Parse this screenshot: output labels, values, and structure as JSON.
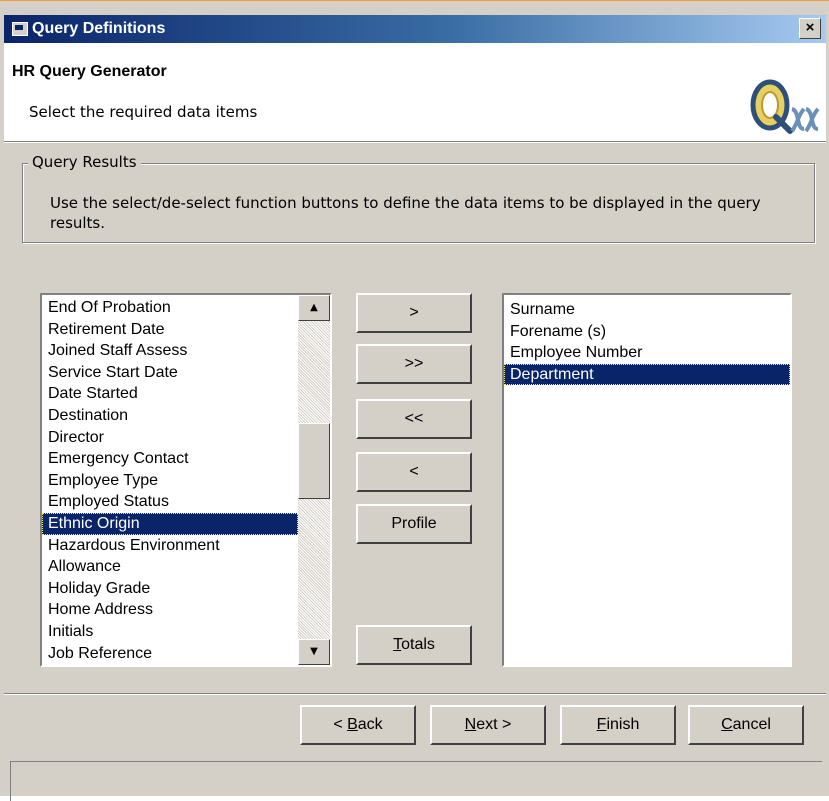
{
  "window": {
    "title": "Query Definitions",
    "close_label": "×"
  },
  "header": {
    "title": "HR Query Generator",
    "subtitle": "Select the required data items"
  },
  "group": {
    "legend": "Query Results",
    "text": "Use the select/de-select function buttons to define the data items to be displayed in the query results."
  },
  "available_items": [
    "End Of Probation",
    "Retirement Date",
    "Joined Staff Assess",
    "Service Start Date",
    "Date Started",
    "Destination",
    "Director",
    "Emergency Contact",
    "Employee Type",
    "Employed Status",
    "Ethnic Origin",
    "Hazardous Environment",
    "Allowance",
    "Holiday Grade",
    "Home Address",
    "Initials",
    "Job Reference"
  ],
  "available_selected": "Ethnic Origin",
  "selected_items": [
    "Surname",
    "Forename (s)",
    "Employee Number",
    "Department"
  ],
  "selected_selected": "Department",
  "buttons": {
    "add_one": ">",
    "add_all": ">>",
    "remove_all": "<<",
    "remove_one": "<",
    "profile": "Profile",
    "totals_key": "T",
    "totals_rest": "otals",
    "back_prefix": "< ",
    "back_key": "B",
    "back_rest": "ack",
    "next_key": "N",
    "next_rest": "ext >",
    "finish_key": "F",
    "finish_rest": "inish",
    "cancel_key": "C",
    "cancel_rest": "ancel"
  }
}
